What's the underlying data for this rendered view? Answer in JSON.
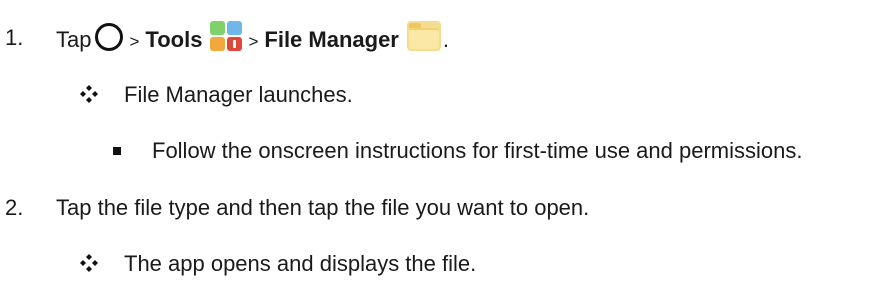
{
  "step1": {
    "number": "1.",
    "tap_label": "Tap",
    "sep1": ">",
    "tools_label": "Tools",
    "sep2": ">",
    "file_manager_label": "File Manager",
    "end": ".",
    "icons": {
      "home": "home-circle-icon",
      "tools": "tools-folder-icon",
      "file_manager": "file-manager-folder-icon"
    }
  },
  "step1_result": {
    "bullet_icon": "four-diamond-bullet-icon",
    "text": "File Manager launches."
  },
  "step1_note": {
    "text": "Follow the onscreen instructions for first-time use and permissions."
  },
  "step2": {
    "number": "2.",
    "text": "Tap the file type and then tap the file you want to open."
  },
  "step2_result": {
    "bullet_icon": "four-diamond-bullet-icon",
    "text": "The app opens and displays the file."
  }
}
